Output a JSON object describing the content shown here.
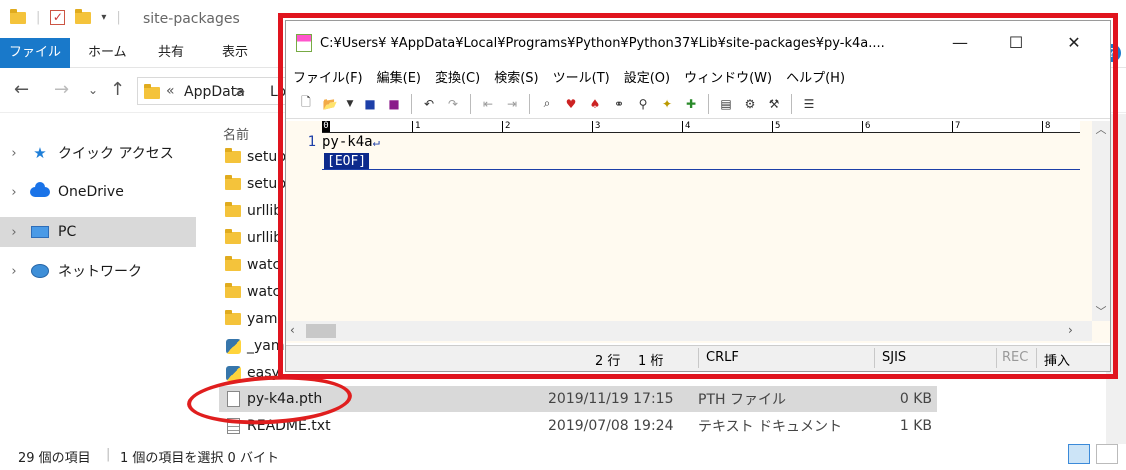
{
  "explorer": {
    "title": "site-packages",
    "ribbon": {
      "file": "ファイル",
      "home": "ホーム",
      "share": "共有",
      "view": "表示"
    },
    "address": {
      "prefix": "«",
      "part1": "AppData",
      "part2": "Lo"
    },
    "help": "?",
    "nav": [
      {
        "label": "クイック アクセス",
        "icon": "star-icon"
      },
      {
        "label": "OneDrive",
        "icon": "cloud-icon"
      },
      {
        "label": "PC",
        "icon": "pc-icon"
      },
      {
        "label": "ネットワーク",
        "icon": "network-icon"
      }
    ],
    "column_name": "名前",
    "rows": [
      {
        "name": "setup",
        "type": "folder"
      },
      {
        "name": "setup",
        "type": "folder"
      },
      {
        "name": "urllib",
        "type": "folder"
      },
      {
        "name": "urllib",
        "type": "folder"
      },
      {
        "name": "watc",
        "type": "folder"
      },
      {
        "name": "watc",
        "type": "folder"
      },
      {
        "name": "yam",
        "type": "folder"
      },
      {
        "name": "_yam",
        "type": "python"
      },
      {
        "name": "easy",
        "type": "python"
      }
    ],
    "selected_file": {
      "name": "py-k4a.pth",
      "date": "2019/11/19 17:15",
      "kind": "PTH ファイル",
      "size": "0 KB"
    },
    "readme": {
      "name": "README.txt",
      "date": "2019/07/08 19:24",
      "kind": "テキスト ドキュメント",
      "size": "1 KB"
    },
    "status": {
      "count": "29 個の項目",
      "selected": "1 個の項目を選択  0 バイト"
    }
  },
  "editor": {
    "title": "C:¥Users¥          ¥AppData¥Local¥Programs¥Python¥Python37¥Lib¥site-packages¥py-k4a....",
    "menu": [
      "ファイル(F)",
      "編集(E)",
      "変換(C)",
      "検索(S)",
      "ツール(T)",
      "設定(O)",
      "ウィンドウ(W)",
      "ヘルプ(H)"
    ],
    "ruler_ticks": [
      "1",
      "2",
      "3",
      "4",
      "5",
      "6",
      "7",
      "8"
    ],
    "ruler_zero": "0",
    "line_number": "1",
    "line_text": "py-k4a",
    "line_end": "↵",
    "eof": "[EOF]",
    "status": {
      "line": "2 行",
      "col": "1 桁",
      "eol": "CRLF",
      "encoding": "SJIS",
      "rec": "REC",
      "mode": "挿入"
    }
  },
  "colors": {
    "annotation": "#e01e1e",
    "accent": "#1979ca",
    "eof_bg": "#0d2a8c"
  }
}
